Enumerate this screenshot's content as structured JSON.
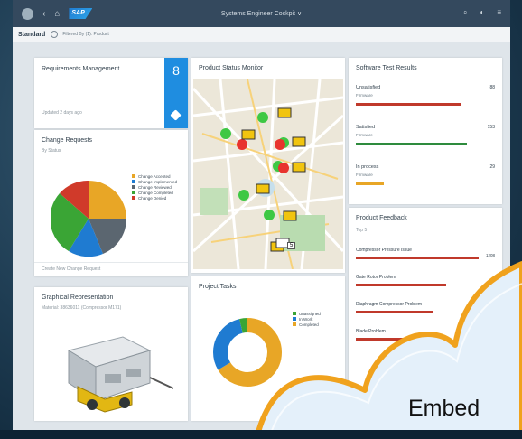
{
  "shell": {
    "title": "Systems Engineer Cockpit",
    "title_caret": "∨",
    "logo": "SAP",
    "variant": "Standard",
    "filter_text": "Filtered By (1): Product"
  },
  "tiles": {
    "requirements": {
      "title": "Requirements Management",
      "count": "8",
      "updated": "Updated 2 days ago"
    },
    "change_requests": {
      "title": "Change Requests",
      "subtitle": "By Status",
      "footer": "Create New Change Request",
      "legend": [
        "Change Accepted",
        "Change Implemented",
        "Change Reviewed",
        "Change Completed",
        "Change Denied"
      ]
    },
    "graphical": {
      "title": "Graphical Representation",
      "subtitle": "Material: 38636011 (Compressor M171)"
    },
    "product_status": {
      "title": "Product Status Monitor",
      "map_badge": "5"
    },
    "project_tasks": {
      "title": "Project Tasks",
      "legend": [
        "Unassigned",
        "In Work",
        "Completed"
      ]
    },
    "software_test": {
      "title": "Software Test Results",
      "rows": [
        {
          "label": "Unsatisfied",
          "sub": "Firmware",
          "value": "88",
          "fraction": 0.75,
          "color": "#c0392b"
        },
        {
          "label": "Satisfied",
          "sub": "Firmware",
          "value": "153",
          "fraction": 0.8,
          "color": "#2e8b3d"
        },
        {
          "label": "In process",
          "sub": "Firmware",
          "value": "29",
          "fraction": 0.2,
          "color": "#e8a626"
        }
      ]
    },
    "feedback": {
      "title": "Product Feedback",
      "subtitle": "Top 5",
      "rows": [
        {
          "label": "Compressor Pressure Issue",
          "value": "1208",
          "fraction": 0.88
        },
        {
          "label": "Gate Rotor Problem",
          "value": "",
          "fraction": 0.65
        },
        {
          "label": "Diaphragm Compressor Problem",
          "value": "",
          "fraction": 0.55
        },
        {
          "label": "Blade Problem",
          "value": "",
          "fraction": 0.45
        }
      ]
    }
  },
  "overlay_text": "Embed",
  "colors": {
    "accent": "#1f8de0",
    "map_green": "#3ec844",
    "map_red": "#e8342e",
    "map_truck": "#f1c40f",
    "cloud_fill": "#e4f0fa",
    "cloud_border": "#f0a21d"
  }
}
